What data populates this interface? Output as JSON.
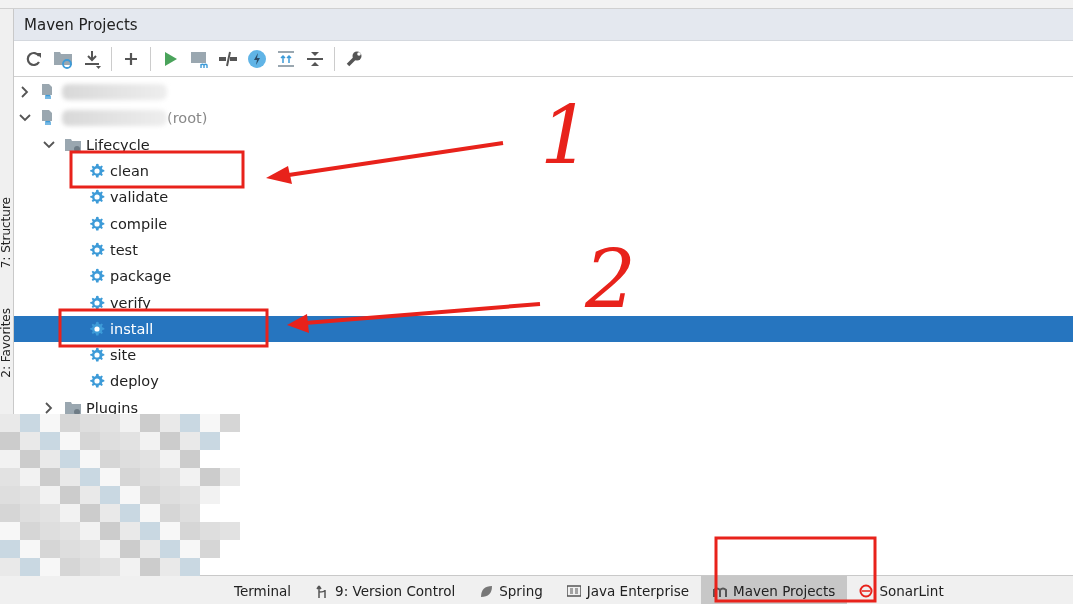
{
  "panel": {
    "title": "Maven Projects"
  },
  "side_tabs": [
    {
      "label": "7: Structure"
    },
    {
      "label": "2: Favorites"
    }
  ],
  "tree": [
    {
      "kind": "project",
      "expanded": false,
      "selected": false
    },
    {
      "kind": "project",
      "label": "(root)",
      "expanded": true,
      "selected": false,
      "children": [
        {
          "kind": "folder",
          "label": "Lifecycle",
          "expanded": true,
          "selected": false,
          "children": [
            {
              "kind": "goal",
              "label": "clean",
              "selected": false
            },
            {
              "kind": "goal",
              "label": "validate",
              "selected": false
            },
            {
              "kind": "goal",
              "label": "compile",
              "selected": false
            },
            {
              "kind": "goal",
              "label": "test",
              "selected": false
            },
            {
              "kind": "goal",
              "label": "package",
              "selected": false
            },
            {
              "kind": "goal",
              "label": "verify",
              "selected": false
            },
            {
              "kind": "goal",
              "label": "install",
              "selected": true
            },
            {
              "kind": "goal",
              "label": "site",
              "selected": false
            },
            {
              "kind": "goal",
              "label": "deploy",
              "selected": false
            }
          ]
        },
        {
          "kind": "folder",
          "label": "Plugins",
          "expanded": false,
          "selected": false
        }
      ]
    }
  ],
  "bottom_tabs": [
    {
      "label": "Terminal",
      "selected": false
    },
    {
      "label": "9: Version Control",
      "selected": false
    },
    {
      "label": "Spring",
      "selected": false
    },
    {
      "label": "Java Enterprise",
      "selected": false
    },
    {
      "label": "Maven Projects",
      "selected": true
    },
    {
      "label": "SonarLint",
      "selected": false
    }
  ],
  "annotations": [
    {
      "label": "1"
    },
    {
      "label": "2"
    }
  ]
}
